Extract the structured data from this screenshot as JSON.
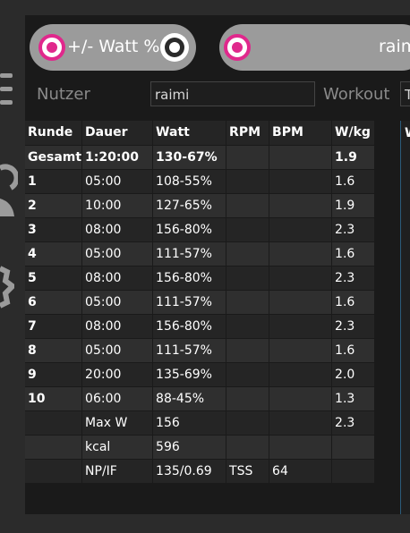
{
  "mode_toggle": {
    "left_label": "+/- Watt %",
    "right_label": "raimi"
  },
  "fields": {
    "user_label": "Nutzer",
    "user_value": "raimi",
    "workout_label": "Workout",
    "workout_value": "T"
  },
  "side_pane": {
    "label": "W"
  },
  "table": {
    "headers": [
      "Runde",
      "Dauer",
      "Watt",
      "RPM",
      "BPM",
      "W/kg"
    ],
    "rows": [
      [
        "Gesamt",
        "1:20:00",
        "130-67%",
        "",
        "",
        "1.9"
      ],
      [
        "1",
        "05:00",
        "108-55%",
        "",
        "",
        "1.6"
      ],
      [
        "2",
        "10:00",
        "127-65%",
        "",
        "",
        "1.9"
      ],
      [
        "3",
        "08:00",
        "156-80%",
        "",
        "",
        "2.3"
      ],
      [
        "4",
        "05:00",
        "111-57%",
        "",
        "",
        "1.6"
      ],
      [
        "5",
        "08:00",
        "156-80%",
        "",
        "",
        "2.3"
      ],
      [
        "6",
        "05:00",
        "111-57%",
        "",
        "",
        "1.6"
      ],
      [
        "7",
        "08:00",
        "156-80%",
        "",
        "",
        "2.3"
      ],
      [
        "8",
        "05:00",
        "111-57%",
        "",
        "",
        "1.6"
      ],
      [
        "9",
        "20:00",
        "135-69%",
        "",
        "",
        "2.0"
      ],
      [
        "10",
        "06:00",
        "88-45%",
        "",
        "",
        "1.3"
      ],
      [
        "",
        "Max W",
        "156",
        "",
        "",
        "2.3"
      ],
      [
        "",
        "kcal",
        "596",
        "",
        "",
        ""
      ],
      [
        "",
        "NP/IF",
        "135/0.69",
        "TSS",
        "64",
        ""
      ]
    ]
  },
  "colors": {
    "accent": "#e0288c",
    "panel_bg": "#1a1a1a",
    "app_bg": "#2b2b2b"
  }
}
